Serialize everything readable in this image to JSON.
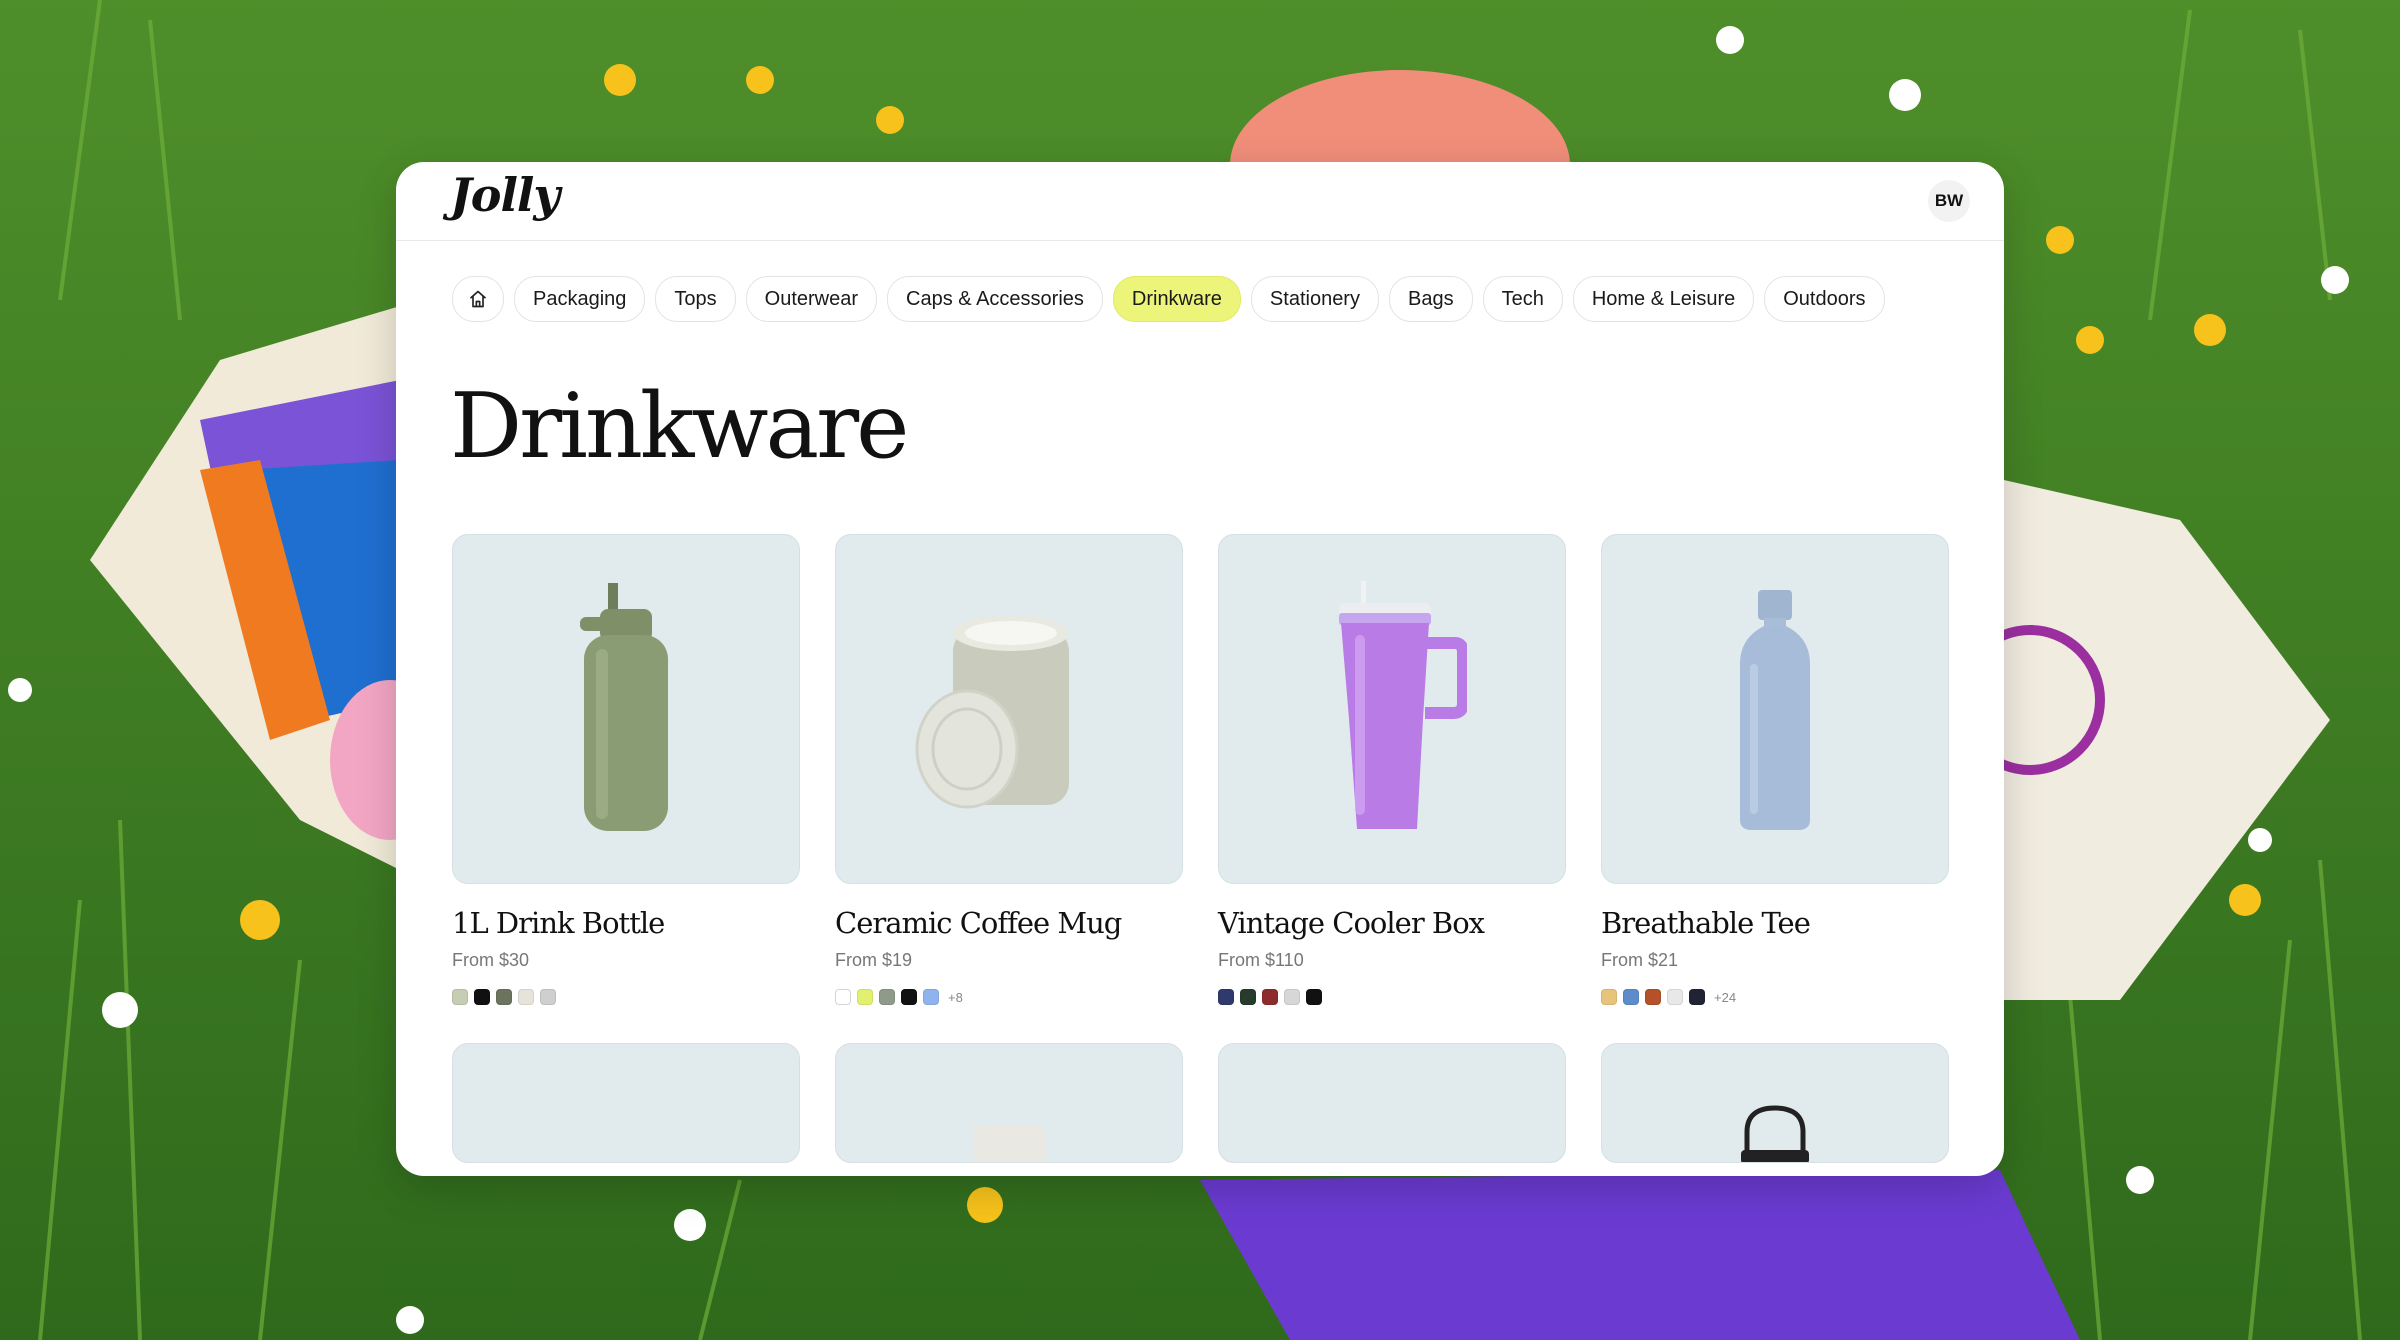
{
  "app": {
    "logo_text": "Jolly",
    "user_initials": "BW"
  },
  "nav": {
    "items": [
      {
        "label": "Packaging"
      },
      {
        "label": "Tops"
      },
      {
        "label": "Outerwear"
      },
      {
        "label": "Caps & Accessories"
      },
      {
        "label": "Drinkware",
        "active": true
      },
      {
        "label": "Stationery"
      },
      {
        "label": "Bags"
      },
      {
        "label": "Tech"
      },
      {
        "label": "Home & Leisure"
      },
      {
        "label": "Outdoors"
      }
    ]
  },
  "page": {
    "title": "Drinkware"
  },
  "products": [
    {
      "name": "1L Drink Bottle",
      "price": "From $30",
      "icon": "green-water-bottle",
      "swatches": [
        "#c5cdb2",
        "#111111",
        "#6c735e",
        "#e6e3da",
        "#cfcfcf"
      ],
      "more": ""
    },
    {
      "name": "Ceramic Coffee Mug",
      "price": "From $19",
      "icon": "ceramic-mug",
      "swatches": [
        "#ffffff",
        "#e3ef6e",
        "#8f9a88",
        "#111111",
        "#8fb3ee"
      ],
      "more": "+8"
    },
    {
      "name": "Vintage Cooler Box",
      "price": "From $110",
      "icon": "purple-tumbler",
      "swatches": [
        "#2e3a6e",
        "#263b2c",
        "#8e2c2c",
        "#d7d7d7",
        "#111111"
      ],
      "more": ""
    },
    {
      "name": "Breathable Tee",
      "price": "From $21",
      "icon": "blue-bottle",
      "swatches": [
        "#e8c37a",
        "#5e8bcc",
        "#b5512a",
        "#e8e8e8",
        "#1f2333"
      ],
      "more": "+24"
    }
  ],
  "colors": {
    "accent": "#ecf57a",
    "card_bg": "#e1ebee"
  }
}
